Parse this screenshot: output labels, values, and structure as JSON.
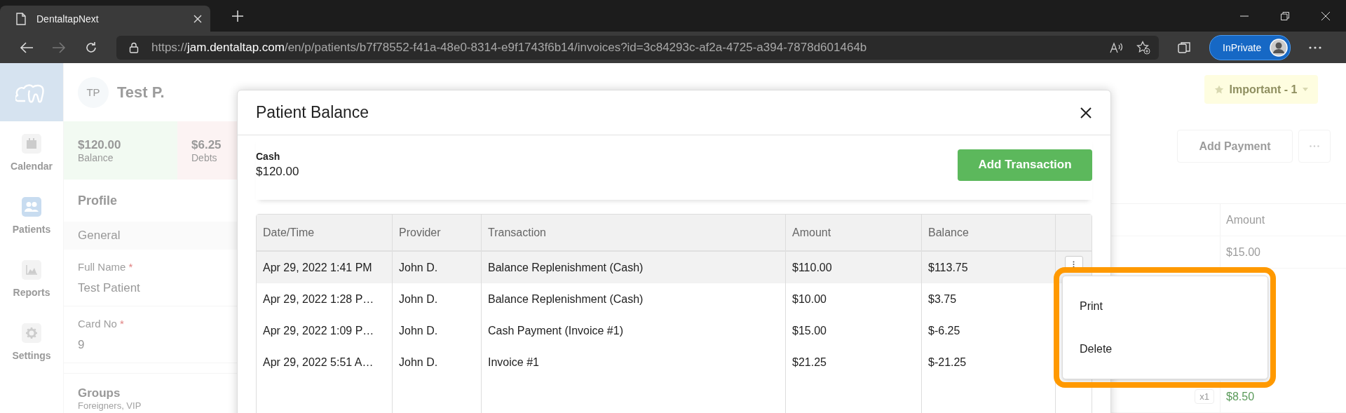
{
  "browser": {
    "tab_title": "DentaltapNext",
    "url_host": "jam.dentaltap.com",
    "url_path": "/en/p/patients/b7f78552-f41a-48e0-8314-e9f1743f6b14/invoices?id=3c84293c-af2a-4725-a394-7878d601464b",
    "url_scheme": "https://",
    "profile_label": "InPrivate"
  },
  "sidebar": {
    "items": [
      {
        "label": "Calendar",
        "kind": "calendar",
        "selected": false
      },
      {
        "label": "Patients",
        "kind": "patients",
        "selected": true
      },
      {
        "label": "Reports",
        "kind": "reports",
        "selected": false
      },
      {
        "label": "Settings",
        "kind": "settings",
        "selected": false
      }
    ]
  },
  "patient": {
    "initials": "TP",
    "name": "Test P.",
    "important_label": "Important - 1",
    "summary": [
      {
        "amount": "$120.00",
        "label": "Balance",
        "kind": "credit"
      },
      {
        "amount": "$6.25",
        "label": "Debts",
        "kind": "debt"
      }
    ],
    "profile_heading": "Profile",
    "section": "General",
    "fields": [
      {
        "label": "Full Name",
        "required_mark": "*",
        "value": "Test Patient"
      },
      {
        "label": "Card No",
        "required_mark": "*",
        "value": "9"
      }
    ],
    "groups": {
      "label": "Groups",
      "value": "Foreigners, VIP"
    }
  },
  "invoices": {
    "add_payment": "Add Payment",
    "column": "Amount",
    "rows": [
      {
        "qty": "",
        "amount": "$15.00"
      },
      {
        "qty": "x1",
        "amount": "$8.50"
      }
    ]
  },
  "modal": {
    "title": "Patient Balance",
    "account": {
      "label": "Cash",
      "amount": "$120.00"
    },
    "add_button": "Add Transaction",
    "columns": [
      "Date/Time",
      "Provider",
      "Transaction",
      "Amount",
      "Balance"
    ],
    "rows": [
      {
        "date": "Apr 29, 2022 1:41 PM",
        "provider": "John D.",
        "transaction": "Balance Replenishment (Cash)",
        "amount": "$110.00",
        "balance": "$113.75",
        "selected": true
      },
      {
        "date": "Apr 29, 2022 1:28 P…",
        "provider": "John D.",
        "transaction": "Balance Replenishment (Cash)",
        "amount": "$10.00",
        "balance": "$3.75",
        "selected": false
      },
      {
        "date": "Apr 29, 2022 1:09 P…",
        "provider": "John D.",
        "transaction": "Cash Payment (Invoice #1)",
        "amount": "$15.00",
        "balance": "$-6.25",
        "selected": false
      },
      {
        "date": "Apr 29, 2022 5:51 A…",
        "provider": "John D.",
        "transaction": "Invoice #1",
        "amount": "$21.25",
        "balance": "$-21.25",
        "selected": false
      }
    ],
    "menu": {
      "items": [
        "Print",
        "Delete"
      ]
    }
  }
}
